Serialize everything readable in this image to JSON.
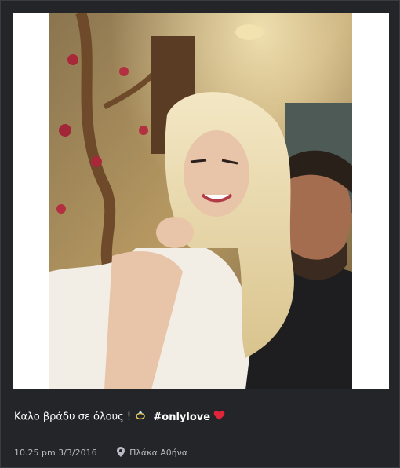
{
  "post": {
    "photo_alt": "",
    "caption_text": "Καλο βράδυ σε όλους !",
    "hashtag": "#onlylove",
    "timestamp": "10.25 pm 3/3/2016",
    "location": "Πλάκα Αθήνα"
  },
  "icons": {
    "caption_emoji_1": "ring-icon",
    "caption_emoji_2": "heart-icon",
    "location": "map-pin-icon"
  },
  "colors": {
    "background": "#232528",
    "text": "#ffffff",
    "meta_text": "#b8bcc2",
    "heart": "#e0243a"
  }
}
